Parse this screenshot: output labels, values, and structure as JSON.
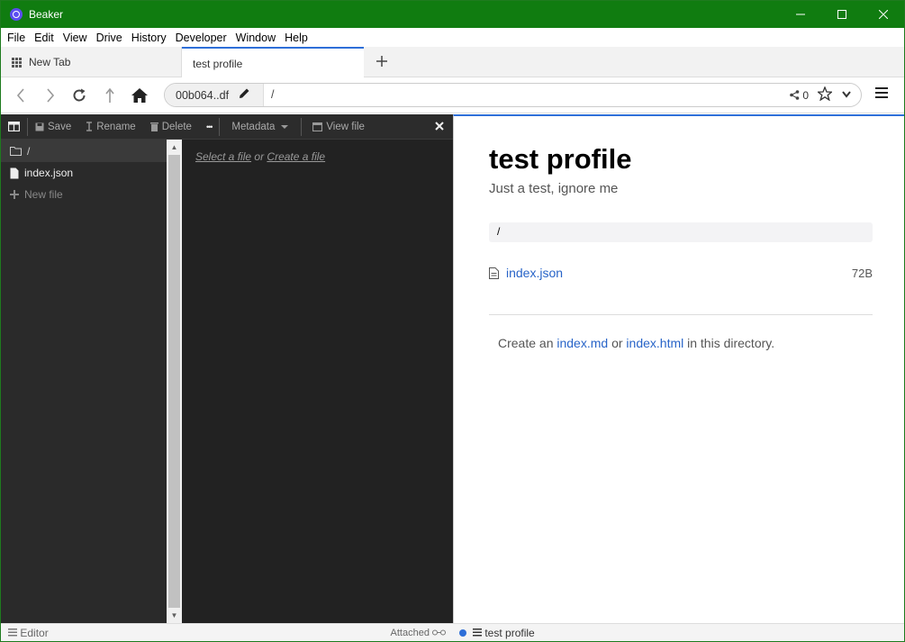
{
  "window": {
    "title": "Beaker"
  },
  "menubar": {
    "items": [
      "File",
      "Edit",
      "View",
      "Drive",
      "History",
      "Developer",
      "Window",
      "Help"
    ]
  },
  "tabs": [
    {
      "label": "New Tab",
      "active": false
    },
    {
      "label": "test profile",
      "active": true
    }
  ],
  "urlbar": {
    "origin": "00b064..df",
    "path": "/",
    "peer_count": "0"
  },
  "editor": {
    "toolbar": {
      "save": "Save",
      "rename": "Rename",
      "delete": "Delete",
      "more": "•••",
      "metadata": "Metadata",
      "view_file": "View file"
    },
    "tree": {
      "root": "/",
      "files": [
        "index.json"
      ],
      "new_file": "New file"
    },
    "placeholder": {
      "select": "Select a file",
      "or": "or",
      "create": "Create a file"
    },
    "status": {
      "mode": "Editor",
      "attached": "Attached"
    }
  },
  "preview": {
    "title": "test profile",
    "subtitle": "Just a test, ignore me",
    "path": "/",
    "files": [
      {
        "name": "index.json",
        "size": "72B"
      }
    ],
    "create_prefix": "Create an",
    "create_md": "index.md",
    "create_or": "or",
    "create_html": "index.html",
    "create_suffix": "in this directory.",
    "status_label": "test profile"
  },
  "colors": {
    "titlebar": "#107c10",
    "accent": "#2e6fd8",
    "link": "#2864c8"
  }
}
